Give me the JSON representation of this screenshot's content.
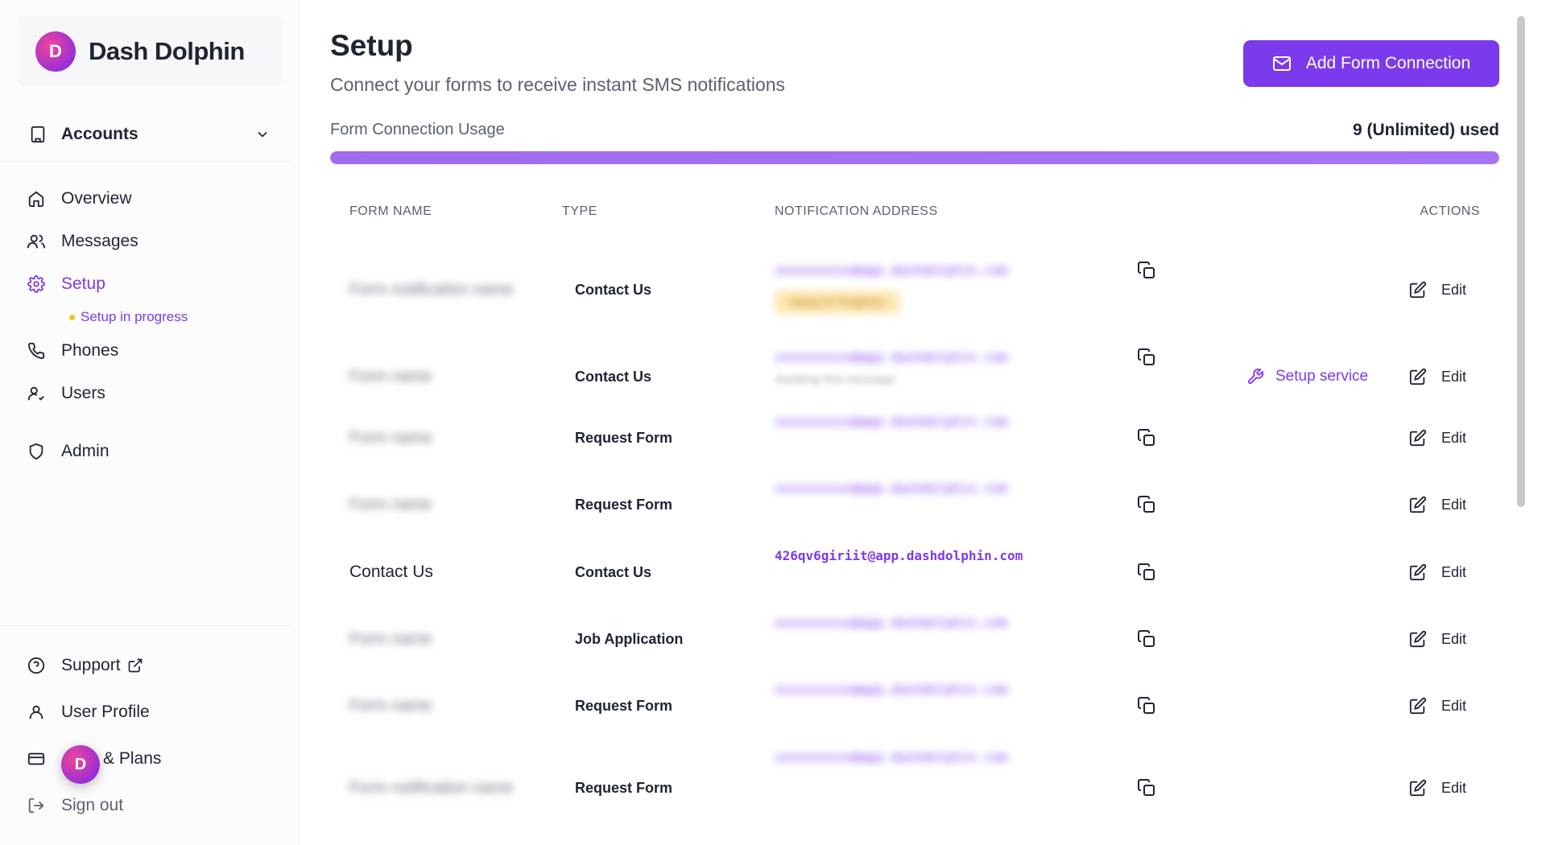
{
  "brand": {
    "name": "Dash Dolphin",
    "logo_glyph": "D"
  },
  "sidebar": {
    "accounts_label": "Accounts",
    "nav": [
      {
        "label": "Overview",
        "icon": "home-icon"
      },
      {
        "label": "Messages",
        "icon": "users-icon"
      },
      {
        "label": "Setup",
        "icon": "gear-icon",
        "active": true,
        "sub": "Setup in progress"
      },
      {
        "label": "Phones",
        "icon": "phone-icon"
      },
      {
        "label": "Users",
        "icon": "user-check-icon"
      },
      {
        "label": "Admin",
        "icon": "shield-icon"
      }
    ],
    "bottom": [
      {
        "label": "Support",
        "icon": "help-circle-icon"
      },
      {
        "label": "User Profile",
        "icon": "user-icon"
      },
      {
        "label": "& Plans",
        "icon": "credit-card-icon"
      },
      {
        "label": "Sign out",
        "icon": "sign-out-icon"
      }
    ]
  },
  "header": {
    "title": "Setup",
    "subtitle": "Connect your forms to receive instant SMS notifications",
    "add_button": "Add Form Connection"
  },
  "usage": {
    "label": "Form Connection Usage",
    "value": "9 (Unlimited) used",
    "fill_fraction": 1.0
  },
  "table": {
    "headers": {
      "form_name": "FORM NAME",
      "type": "TYPE",
      "address": "NOTIFICATION ADDRESS",
      "actions": "ACTIONS"
    },
    "rows": [
      {
        "name": "Form notification name",
        "name_blurred": true,
        "type": "Contact Us",
        "address": "xxxxxxxxxx@app.dashdolphin.com",
        "address_blurred": true,
        "badge": "Setup in Progress",
        "edit": "Edit"
      },
      {
        "name": "Form name",
        "name_blurred": true,
        "type": "Contact Us",
        "address": "xxxxxxxxxx@app.dashdolphin.com",
        "address_blurred": true,
        "subnote": "Awaiting first message",
        "setup_service": "Setup service",
        "edit": "Edit"
      },
      {
        "name": "Form name",
        "name_blurred": true,
        "type": "Request Form",
        "address": "xxxxxxxxxx@app.dashdolphin.com",
        "address_blurred": true,
        "edit": "Edit"
      },
      {
        "name": "Form name",
        "name_blurred": true,
        "type": "Request Form",
        "address": "xxxxxxxxxx@app.dashdolphin.com",
        "address_blurred": true,
        "edit": "Edit"
      },
      {
        "name": "Contact Us",
        "name_blurred": false,
        "type": "Contact Us",
        "address": "426qv6giriit@app.dashdolphin.com",
        "address_blurred": false,
        "edit": "Edit"
      },
      {
        "name": "Form name",
        "name_blurred": true,
        "type": "Job Application",
        "address": "xxxxxxxxxx@app.dashdolphin.com",
        "address_blurred": true,
        "edit": "Edit"
      },
      {
        "name": "Form name",
        "name_blurred": true,
        "type": "Request Form",
        "address": "xxxxxxxxxx@app.dashdolphin.com",
        "address_blurred": true,
        "edit": "Edit"
      },
      {
        "name": "Form notification name",
        "name_blurred": true,
        "type": "Request Form",
        "address": "xxxxxxxxxx@app.dashdolphin.com",
        "address_blurred": true,
        "edit": "Edit"
      }
    ]
  },
  "colors": {
    "accent": "#7c3aed",
    "text": "#1f2432",
    "muted": "#5b6170",
    "badge": "#f5c518"
  }
}
